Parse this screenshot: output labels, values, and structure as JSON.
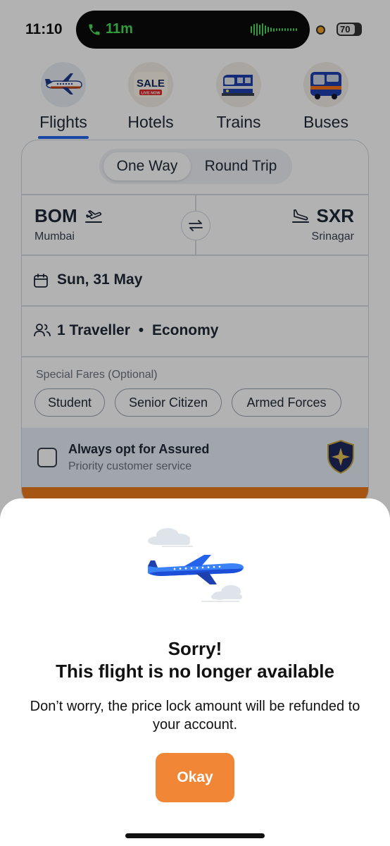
{
  "status_bar": {
    "time": "11:10",
    "call_duration": "11m",
    "battery": "70",
    "call_color": "#4ade5a"
  },
  "categories": [
    {
      "label": "Flights",
      "icon": "airplane-icon",
      "active": true
    },
    {
      "label": "Hotels",
      "icon": "sale-badge-icon",
      "badge_text": "SALE",
      "badge_sub": "LIVE NOW",
      "active": false
    },
    {
      "label": "Trains",
      "icon": "train-icon",
      "active": false
    },
    {
      "label": "Buses",
      "icon": "bus-icon",
      "active": false
    }
  ],
  "search": {
    "trip_type": {
      "options": [
        "One Way",
        "Round Trip"
      ],
      "selected": "One Way"
    },
    "from": {
      "code": "BOM",
      "city": "Mumbai"
    },
    "to": {
      "code": "SXR",
      "city": "Srinagar"
    },
    "date": "Sun, 31 May",
    "travellers": "1 Traveller",
    "separator": "•",
    "cabin_class": "Economy",
    "special_fares_label": "Special Fares (Optional)",
    "special_fares": [
      "Student",
      "Senior Citizen",
      "Armed Forces"
    ],
    "assured": {
      "title": "Always opt for Assured",
      "subtitle": "Priority customer service",
      "checked": false
    }
  },
  "dialog": {
    "title_line1": "Sorry!",
    "title_line2": "This flight is no longer available",
    "message": "Don’t worry, the price lock amount will be refunded to your account.",
    "button_label": "Okay",
    "button_color": "#f08636"
  },
  "colors": {
    "accent_blue": "#2563eb",
    "brand_orange": "#f07a1a"
  }
}
